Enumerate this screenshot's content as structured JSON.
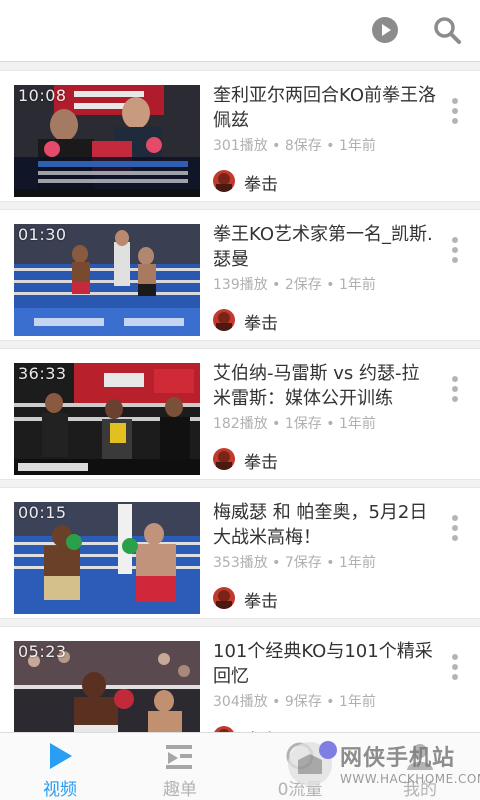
{
  "videos": [
    {
      "duration": "10:08",
      "title": "奎利亚尔两回合KO前拳王洛佩兹",
      "meta": "301播放 • 8保存 • 1年前",
      "uploader": "拳击"
    },
    {
      "duration": "01:30",
      "title": "拳王KO艺术家第一名_凯斯.瑟曼",
      "meta": "139播放 • 2保存 • 1年前",
      "uploader": "拳击"
    },
    {
      "duration": "36:33",
      "title": "艾伯纳-马雷斯 vs 约瑟-拉米雷斯：媒体公开训练",
      "meta": "182播放 • 1保存 • 1年前",
      "uploader": "拳击"
    },
    {
      "duration": "00:15",
      "title": "梅威瑟 和 帕奎奥，5月2日大战米高梅！",
      "meta": "353播放 • 7保存 • 1年前",
      "uploader": "拳击"
    },
    {
      "duration": "05:23",
      "title": "101个经典KO与101个精采回忆",
      "meta": "304播放 • 9保存 • 1年前",
      "uploader": "拳击"
    }
  ],
  "tabs": [
    {
      "label": "视频",
      "icon": "play-triangle-icon"
    },
    {
      "label": "趣单",
      "icon": "playlist-icon"
    },
    {
      "label": "0流量",
      "icon": "data-icon"
    },
    {
      "label": "我的",
      "icon": "profile-icon"
    }
  ],
  "watermark": {
    "text": "网侠手机站",
    "url": "WWW.HACKHOME.COM"
  },
  "colors": {
    "accent": "#2a9df4",
    "meta_gray": "#b0b0b0",
    "title": "#333333"
  }
}
